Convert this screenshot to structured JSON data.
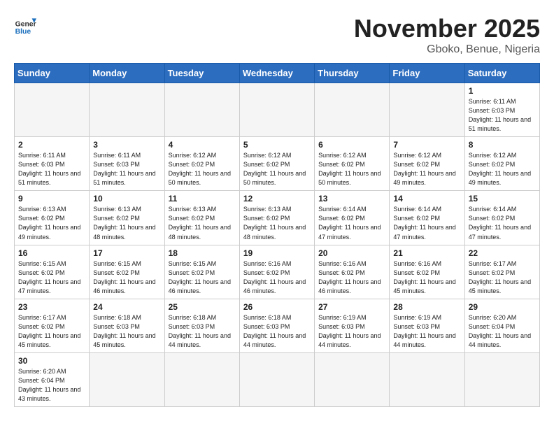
{
  "header": {
    "logo_general": "General",
    "logo_blue": "Blue",
    "month": "November 2025",
    "location": "Gboko, Benue, Nigeria"
  },
  "weekdays": [
    "Sunday",
    "Monday",
    "Tuesday",
    "Wednesday",
    "Thursday",
    "Friday",
    "Saturday"
  ],
  "weeks": [
    [
      {
        "day": "",
        "info": ""
      },
      {
        "day": "",
        "info": ""
      },
      {
        "day": "",
        "info": ""
      },
      {
        "day": "",
        "info": ""
      },
      {
        "day": "",
        "info": ""
      },
      {
        "day": "",
        "info": ""
      },
      {
        "day": "1",
        "info": "Sunrise: 6:11 AM\nSunset: 6:03 PM\nDaylight: 11 hours and 51 minutes."
      }
    ],
    [
      {
        "day": "2",
        "info": "Sunrise: 6:11 AM\nSunset: 6:03 PM\nDaylight: 11 hours and 51 minutes."
      },
      {
        "day": "3",
        "info": "Sunrise: 6:11 AM\nSunset: 6:03 PM\nDaylight: 11 hours and 51 minutes."
      },
      {
        "day": "4",
        "info": "Sunrise: 6:12 AM\nSunset: 6:02 PM\nDaylight: 11 hours and 50 minutes."
      },
      {
        "day": "5",
        "info": "Sunrise: 6:12 AM\nSunset: 6:02 PM\nDaylight: 11 hours and 50 minutes."
      },
      {
        "day": "6",
        "info": "Sunrise: 6:12 AM\nSunset: 6:02 PM\nDaylight: 11 hours and 50 minutes."
      },
      {
        "day": "7",
        "info": "Sunrise: 6:12 AM\nSunset: 6:02 PM\nDaylight: 11 hours and 49 minutes."
      },
      {
        "day": "8",
        "info": "Sunrise: 6:12 AM\nSunset: 6:02 PM\nDaylight: 11 hours and 49 minutes."
      }
    ],
    [
      {
        "day": "9",
        "info": "Sunrise: 6:13 AM\nSunset: 6:02 PM\nDaylight: 11 hours and 49 minutes."
      },
      {
        "day": "10",
        "info": "Sunrise: 6:13 AM\nSunset: 6:02 PM\nDaylight: 11 hours and 48 minutes."
      },
      {
        "day": "11",
        "info": "Sunrise: 6:13 AM\nSunset: 6:02 PM\nDaylight: 11 hours and 48 minutes."
      },
      {
        "day": "12",
        "info": "Sunrise: 6:13 AM\nSunset: 6:02 PM\nDaylight: 11 hours and 48 minutes."
      },
      {
        "day": "13",
        "info": "Sunrise: 6:14 AM\nSunset: 6:02 PM\nDaylight: 11 hours and 47 minutes."
      },
      {
        "day": "14",
        "info": "Sunrise: 6:14 AM\nSunset: 6:02 PM\nDaylight: 11 hours and 47 minutes."
      },
      {
        "day": "15",
        "info": "Sunrise: 6:14 AM\nSunset: 6:02 PM\nDaylight: 11 hours and 47 minutes."
      }
    ],
    [
      {
        "day": "16",
        "info": "Sunrise: 6:15 AM\nSunset: 6:02 PM\nDaylight: 11 hours and 47 minutes."
      },
      {
        "day": "17",
        "info": "Sunrise: 6:15 AM\nSunset: 6:02 PM\nDaylight: 11 hours and 46 minutes."
      },
      {
        "day": "18",
        "info": "Sunrise: 6:15 AM\nSunset: 6:02 PM\nDaylight: 11 hours and 46 minutes."
      },
      {
        "day": "19",
        "info": "Sunrise: 6:16 AM\nSunset: 6:02 PM\nDaylight: 11 hours and 46 minutes."
      },
      {
        "day": "20",
        "info": "Sunrise: 6:16 AM\nSunset: 6:02 PM\nDaylight: 11 hours and 46 minutes."
      },
      {
        "day": "21",
        "info": "Sunrise: 6:16 AM\nSunset: 6:02 PM\nDaylight: 11 hours and 45 minutes."
      },
      {
        "day": "22",
        "info": "Sunrise: 6:17 AM\nSunset: 6:02 PM\nDaylight: 11 hours and 45 minutes."
      }
    ],
    [
      {
        "day": "23",
        "info": "Sunrise: 6:17 AM\nSunset: 6:02 PM\nDaylight: 11 hours and 45 minutes."
      },
      {
        "day": "24",
        "info": "Sunrise: 6:18 AM\nSunset: 6:03 PM\nDaylight: 11 hours and 45 minutes."
      },
      {
        "day": "25",
        "info": "Sunrise: 6:18 AM\nSunset: 6:03 PM\nDaylight: 11 hours and 44 minutes."
      },
      {
        "day": "26",
        "info": "Sunrise: 6:18 AM\nSunset: 6:03 PM\nDaylight: 11 hours and 44 minutes."
      },
      {
        "day": "27",
        "info": "Sunrise: 6:19 AM\nSunset: 6:03 PM\nDaylight: 11 hours and 44 minutes."
      },
      {
        "day": "28",
        "info": "Sunrise: 6:19 AM\nSunset: 6:03 PM\nDaylight: 11 hours and 44 minutes."
      },
      {
        "day": "29",
        "info": "Sunrise: 6:20 AM\nSunset: 6:04 PM\nDaylight: 11 hours and 44 minutes."
      }
    ],
    [
      {
        "day": "30",
        "info": "Sunrise: 6:20 AM\nSunset: 6:04 PM\nDaylight: 11 hours and 43 minutes."
      },
      {
        "day": "",
        "info": ""
      },
      {
        "day": "",
        "info": ""
      },
      {
        "day": "",
        "info": ""
      },
      {
        "day": "",
        "info": ""
      },
      {
        "day": "",
        "info": ""
      },
      {
        "day": "",
        "info": ""
      }
    ]
  ]
}
